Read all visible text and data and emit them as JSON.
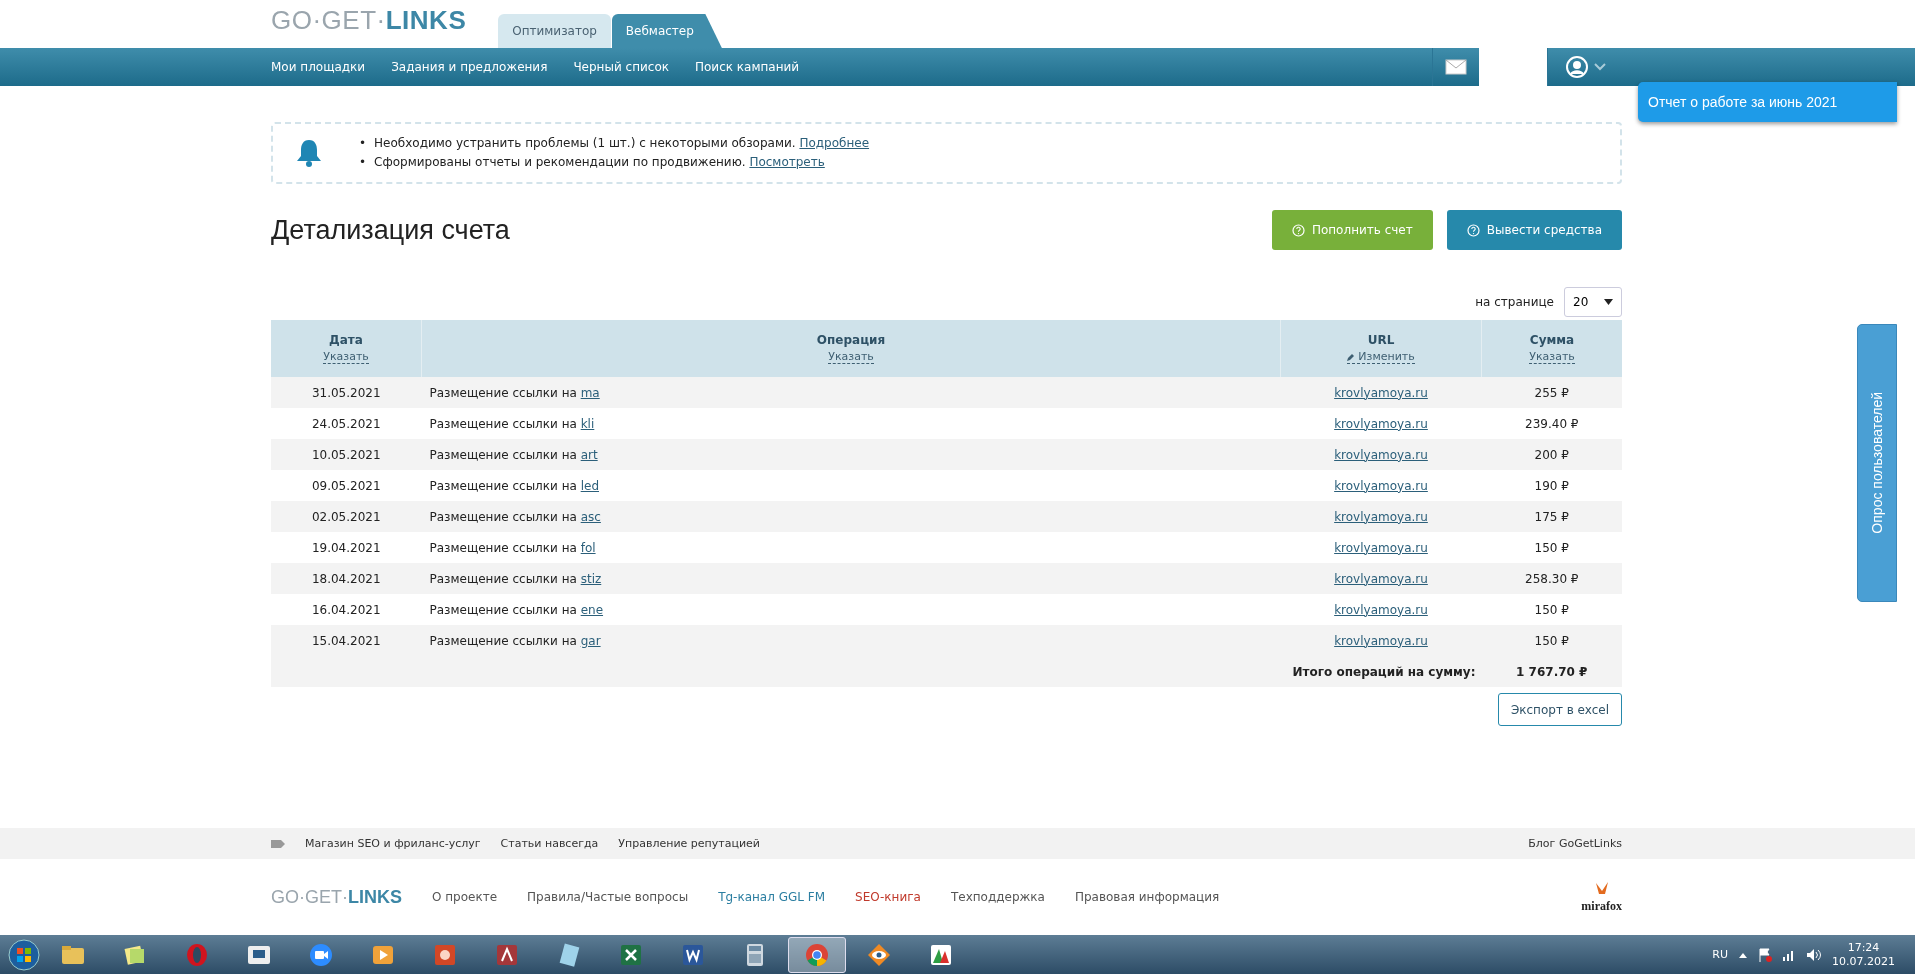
{
  "logo": {
    "light": "GO·GET·",
    "bold": "LINKS"
  },
  "mode_tabs": [
    {
      "label": "Оптимизатор",
      "selected": false
    },
    {
      "label": "Вебмастер",
      "selected": true
    }
  ],
  "nav": [
    "Мои площадки",
    "Задания и предложения",
    "Черный список",
    "Поиск кампаний"
  ],
  "report_popup": "Отчет о работе за июнь 2021",
  "survey_tab": "Опрос пользователей",
  "notices": [
    {
      "bullet": "•",
      "text": "Необходимо устранить проблемы (1 шт.) с некоторыми обзорами.",
      "link": "Подробнее"
    },
    {
      "bullet": "•",
      "text": "Сформированы отчеты и рекомендации по продвижению.",
      "link": "Посмотреть"
    }
  ],
  "page_title": "Детализация счета",
  "actions": [
    {
      "label": "Пополнить счет",
      "kind": "green"
    },
    {
      "label": "Вывести средства",
      "kind": "blue"
    }
  ],
  "per_page": {
    "label": "на странице",
    "value": "20"
  },
  "table": {
    "columns": [
      {
        "title": "Дата",
        "action": "Указать",
        "kind": "plain"
      },
      {
        "title": "Операция",
        "action": "Указать",
        "kind": "plain"
      },
      {
        "title": "URL",
        "action": "Изменить",
        "kind": "edit"
      },
      {
        "title": "Сумма",
        "action": "Указать",
        "kind": "plain"
      }
    ],
    "rows": [
      {
        "date": "31.05.2021",
        "operation": "Размещение ссылки на",
        "link": "ma",
        "url": "krovlyamoya.ru",
        "amount": "255 ₽"
      },
      {
        "date": "24.05.2021",
        "operation": "Размещение ссылки на",
        "link": "kli",
        "url": "krovlyamoya.ru",
        "amount": "239.40 ₽"
      },
      {
        "date": "10.05.2021",
        "operation": "Размещение ссылки на",
        "link": "art",
        "url": "krovlyamoya.ru",
        "amount": "200 ₽"
      },
      {
        "date": "09.05.2021",
        "operation": "Размещение ссылки на",
        "link": "led",
        "url": "krovlyamoya.ru",
        "amount": "190 ₽"
      },
      {
        "date": "02.05.2021",
        "operation": "Размещение ссылки на",
        "link": "asc",
        "url": "krovlyamoya.ru",
        "amount": "175 ₽"
      },
      {
        "date": "19.04.2021",
        "operation": "Размещение ссылки на",
        "link": "fol",
        "url": "krovlyamoya.ru",
        "amount": "150 ₽"
      },
      {
        "date": "18.04.2021",
        "operation": "Размещение ссылки на",
        "link": "stiz",
        "url": "krovlyamoya.ru",
        "amount": "258.30 ₽"
      },
      {
        "date": "16.04.2021",
        "operation": "Размещение ссылки на",
        "link": "ene",
        "url": "krovlyamoya.ru",
        "amount": "150 ₽"
      },
      {
        "date": "15.04.2021",
        "operation": "Размещение ссылки на",
        "link": "gar",
        "url": "krovlyamoya.ru",
        "amount": "150 ₽"
      }
    ],
    "total": {
      "label": "Итого операций на сумму:",
      "value": "1 767.70 ₽"
    }
  },
  "export_button": "Экспорт в excel",
  "footer_links": [
    "Магазин SEO и фриланс-услуг",
    "Статьи навсегда",
    "Управление репутацией"
  ],
  "footer_blog": "Блог GoGetLinks",
  "footer_logo": {
    "light": "GO·GET·",
    "bold": "LINKS"
  },
  "footer_nav": [
    {
      "label": "О проекте",
      "color": "#555555"
    },
    {
      "label": "Правила/Частые вопросы",
      "color": "#555555"
    },
    {
      "label": "Tg-канал GGL FM",
      "color": "#2b7ea1"
    },
    {
      "label": "SEO-книга",
      "color": "#c0392b"
    },
    {
      "label": "Техподдержка",
      "color": "#555555"
    },
    {
      "label": "Правовая информация",
      "color": "#555555"
    }
  ],
  "mirafox": "mirafox",
  "taskbar": {
    "apps": [
      {
        "kind": "folder",
        "selected": false
      },
      {
        "kind": "notes",
        "selected": false
      },
      {
        "kind": "opera",
        "selected": false
      },
      {
        "kind": "video",
        "selected": false
      },
      {
        "kind": "zoom",
        "selected": false
      },
      {
        "kind": "player",
        "selected": false
      },
      {
        "kind": "slides",
        "selected": false
      },
      {
        "kind": "database",
        "selected": false
      },
      {
        "kind": "notepad",
        "selected": false
      },
      {
        "kind": "sheet",
        "selected": false
      },
      {
        "kind": "doc",
        "selected": false
      },
      {
        "kind": "calculator",
        "selected": false
      },
      {
        "kind": "chrome",
        "selected": true
      },
      {
        "kind": "eye",
        "selected": false
      },
      {
        "kind": "chart",
        "selected": false
      }
    ],
    "language": "RU",
    "time": "17:24",
    "date": "10.07.2021"
  }
}
